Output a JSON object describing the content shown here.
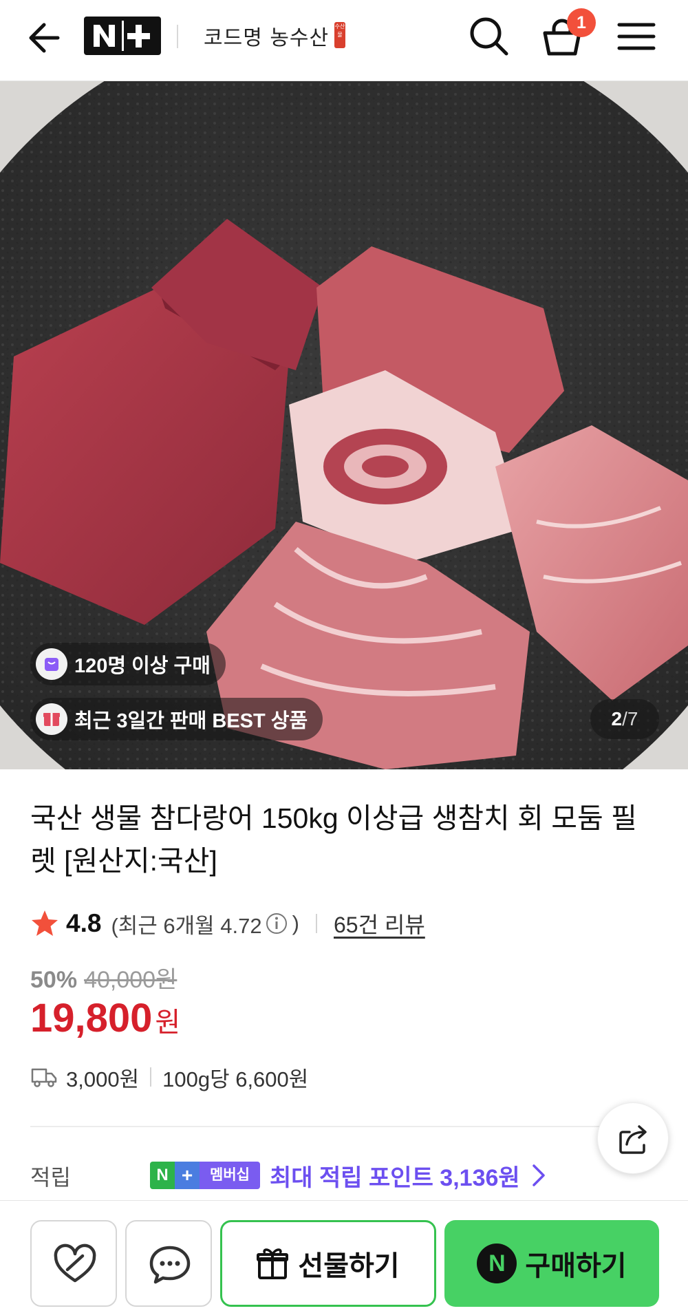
{
  "header": {
    "logo_text": "N+",
    "store_name": "코드명 농수산",
    "store_seal": "수산물",
    "cart_count": "1",
    "icons": [
      "back-arrow-icon",
      "search-icon",
      "shopping-bag-icon",
      "menu-icon"
    ]
  },
  "gallery": {
    "badge_buyers": "120명 이상 구매",
    "badge_best": "최근 3일간 판매 BEST 상품",
    "current_page": "2",
    "separator": "/",
    "total_pages": "7"
  },
  "product": {
    "title": "국산 생물 참다랑어 150kg 이상급 생참치 회 모둠 필렛 [원산지:국산]",
    "rating": "4.8",
    "recent_rating": "(최근 6개월 4.72",
    "recent_rating_close": ")",
    "review_link": "65건 리뷰",
    "discount_rate": "50%",
    "original_price": "40,000원",
    "sale_price": "19,800",
    "price_unit": "원",
    "shipping_fee": "3,000원",
    "unit_price": "100g당 6,600원"
  },
  "points": {
    "label": "적립",
    "membership_n": "N",
    "membership_plus": "+",
    "membership_text": "멤버십",
    "text": "최대 적립 포인트 3,136원"
  },
  "bottom_bar": {
    "gift_label": "선물하기",
    "buy_n": "N",
    "buy_label": "구매하기"
  },
  "colors": {
    "accent_green": "#47d164",
    "price_red": "#d6202b",
    "points_purple": "#6c4ff0",
    "badge_red": "#f2503b"
  }
}
